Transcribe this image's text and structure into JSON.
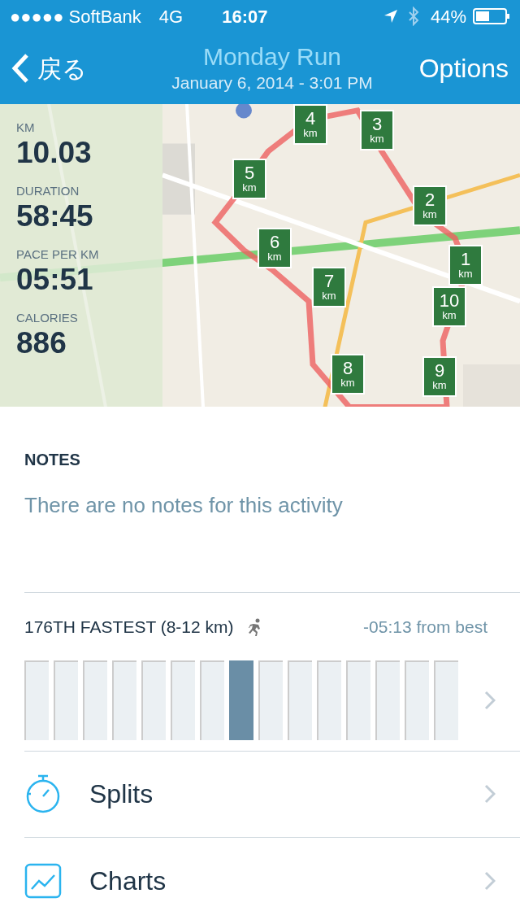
{
  "status_bar": {
    "carrier": "●●●●● SoftBank",
    "network": "4G",
    "time": "16:07",
    "battery": "44%"
  },
  "nav": {
    "back": "戻る",
    "title": "Monday Run",
    "subtitle": "January 6, 2014 - 3:01 PM",
    "action": "Options"
  },
  "stats": [
    {
      "label": "KM",
      "value": "10.03"
    },
    {
      "label": "DURATION",
      "value": "58:45"
    },
    {
      "label": "PACE PER KM",
      "value": "05:51"
    },
    {
      "label": "CALORIES",
      "value": "886"
    }
  ],
  "map": {
    "kind": "picture",
    "markers": [
      {
        "number": "4",
        "unit": "km"
      },
      {
        "number": "3",
        "unit": "km"
      },
      {
        "number": "5",
        "unit": "km"
      },
      {
        "number": "2",
        "unit": "km"
      },
      {
        "number": "6",
        "unit": "km"
      },
      {
        "number": "1",
        "unit": "km"
      },
      {
        "number": "7",
        "unit": "km"
      },
      {
        "number": "10",
        "unit": "km"
      },
      {
        "number": "8",
        "unit": "km"
      },
      {
        "number": "9",
        "unit": "km"
      }
    ]
  },
  "notes": {
    "heading": "NOTES",
    "text": "There are no notes for this activity"
  },
  "ranking": {
    "title": "176TH FASTEST (8-12 km)",
    "difference": "-05:13 from best",
    "bars": [
      {
        "selected": false
      },
      {
        "selected": false
      },
      {
        "selected": false
      },
      {
        "selected": false
      },
      {
        "selected": false
      },
      {
        "selected": false
      },
      {
        "selected": false
      },
      {
        "selected": true
      },
      {
        "selected": false
      },
      {
        "selected": false
      },
      {
        "selected": false
      },
      {
        "selected": false
      },
      {
        "selected": false
      },
      {
        "selected": false
      },
      {
        "selected": false
      }
    ]
  },
  "menu": [
    {
      "kind": "stopwatch",
      "label": "Splits"
    },
    {
      "kind": "chart",
      "label": "Charts"
    }
  ]
}
